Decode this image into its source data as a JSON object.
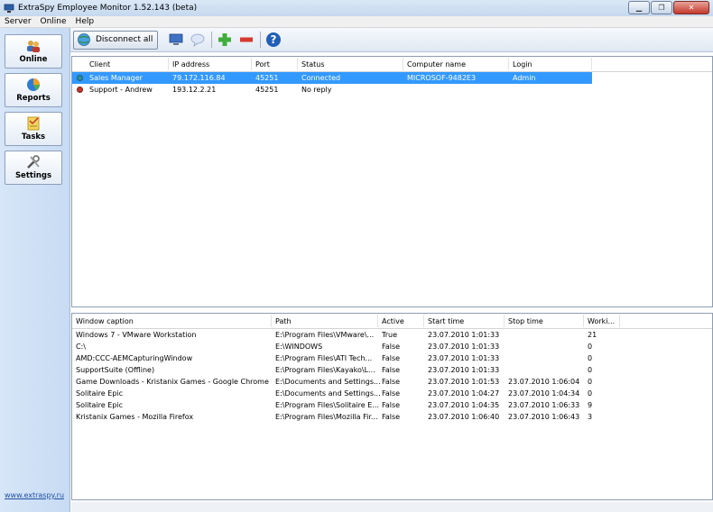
{
  "window": {
    "title": "ExtraSpy Employee Monitor 1.52.143 (beta)"
  },
  "menu": [
    "Server",
    "Online",
    "Help"
  ],
  "sidebar": {
    "items": [
      {
        "label": "Online",
        "icon": "users-icon"
      },
      {
        "label": "Reports",
        "icon": "pie-chart-icon"
      },
      {
        "label": "Tasks",
        "icon": "tasks-icon"
      },
      {
        "label": "Settings",
        "icon": "tools-icon"
      }
    ],
    "link": "www.extraspy.ru"
  },
  "toolbar": {
    "disconnect_label": "Disconnect all"
  },
  "clients": {
    "columns": [
      "Client",
      "IP address",
      "Port",
      "Status",
      "Computer name",
      "Login"
    ],
    "rows": [
      {
        "client": "Sales Manager",
        "ip": "79.172.116.84",
        "port": "45251",
        "status": "Connected",
        "computer": "MICROSOF-9482E3",
        "login": "Admin",
        "state": "connected"
      },
      {
        "client": "Support - Andrew",
        "ip": "193.12.2.21",
        "port": "45251",
        "status": "No reply",
        "computer": "",
        "login": "",
        "state": "noreply"
      }
    ]
  },
  "windows": {
    "columns": [
      "Window caption",
      "Path",
      "Active",
      "Start time",
      "Stop time",
      "Worki..."
    ],
    "rows": [
      {
        "caption": "Windows 7 - VMware Workstation",
        "path": "E:\\Program Files\\VMware\\...",
        "active": "True",
        "start": "23.07.2010 1:01:33",
        "stop": "",
        "work": "21"
      },
      {
        "caption": "C:\\",
        "path": "E:\\WINDOWS",
        "active": "False",
        "start": "23.07.2010 1:01:33",
        "stop": "",
        "work": "0"
      },
      {
        "caption": "AMD:CCC-AEMCapturingWindow",
        "path": "E:\\Program Files\\ATI Tech...",
        "active": "False",
        "start": "23.07.2010 1:01:33",
        "stop": "",
        "work": "0"
      },
      {
        "caption": "SupportSuite (Offline)",
        "path": "E:\\Program Files\\Kayako\\L...",
        "active": "False",
        "start": "23.07.2010 1:01:33",
        "stop": "",
        "work": "0"
      },
      {
        "caption": "Game Downloads - Kristanix Games - Google Chrome",
        "path": "E:\\Documents and Settings...",
        "active": "False",
        "start": "23.07.2010 1:01:53",
        "stop": "23.07.2010 1:06:04",
        "work": "0"
      },
      {
        "caption": "Solitaire Epic",
        "path": "E:\\Documents and Settings...",
        "active": "False",
        "start": "23.07.2010 1:04:27",
        "stop": "23.07.2010 1:04:34",
        "work": "0"
      },
      {
        "caption": "Solitaire Epic",
        "path": "E:\\Program Files\\Solitaire E...",
        "active": "False",
        "start": "23.07.2010 1:04:35",
        "stop": "23.07.2010 1:06:33",
        "work": "9"
      },
      {
        "caption": "Kristanix Games - Mozilla Firefox",
        "path": "E:\\Program Files\\Mozilla Fir...",
        "active": "False",
        "start": "23.07.2010 1:06:40",
        "stop": "23.07.2010 1:06:43",
        "work": "3"
      }
    ]
  },
  "colors": {
    "selection": "#3399ff",
    "connected": "#2f8f9d",
    "noreply": "#c0392b",
    "sidebar": "#d0e1f6"
  }
}
